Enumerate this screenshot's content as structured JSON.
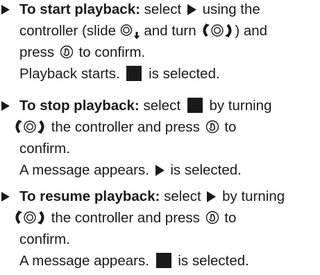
{
  "items": [
    {
      "lead": "To start playback:",
      "l1a": "select",
      "l1b": "using the",
      "l2a": "controller (slide",
      "l2b": "and turn",
      "l2c": ") and",
      "l3a": "press",
      "l3b": "to confirm.",
      "l4a": "Playback starts.",
      "l4b": "is selected."
    },
    {
      "lead": "To stop playback:",
      "l1a": "select",
      "l1b": "by turning",
      "l2a": "the controller and press",
      "l2b": "to",
      "l3a": "confirm.",
      "l4a": "A message appears.",
      "l4b": "is selected."
    },
    {
      "lead": "To resume playback:",
      "l1a": "select",
      "l1b": "by turning",
      "l2a": "the controller and press",
      "l2b": "to",
      "l3a": "confirm.",
      "l4a": "A message appears.",
      "l4b": "is selected."
    }
  ],
  "icons": {
    "play": "play-icon",
    "stop": "stop-icon",
    "slide": "controller-slide-down-icon",
    "turn": "controller-turn-icon",
    "press": "controller-press-icon"
  }
}
